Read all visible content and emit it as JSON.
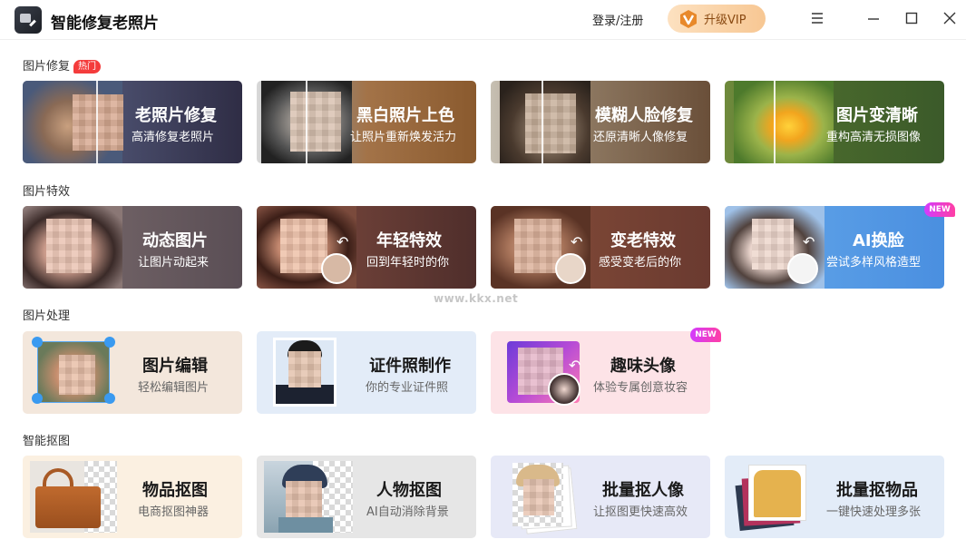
{
  "app": {
    "title": "智能修复老照片"
  },
  "header": {
    "login_label": "登录/注册",
    "vip_label": "升级VIP"
  },
  "sections": {
    "repair": {
      "title": "图片修复",
      "badge": "热门"
    },
    "effects": {
      "title": "图片特效"
    },
    "processing": {
      "title": "图片处理"
    },
    "cutout": {
      "title": "智能抠图"
    }
  },
  "cards": {
    "old_photo": {
      "title": "老照片修复",
      "sub": "高清修复老照片"
    },
    "colorize": {
      "title": "黑白照片上色",
      "sub": "让照片重新焕发活力"
    },
    "blur_face": {
      "title": "模糊人脸修复",
      "sub": "还原清晰人像修复"
    },
    "sharpen": {
      "title": "图片变清晰",
      "sub": "重构高清无损图像"
    },
    "animate": {
      "title": "动态图片",
      "sub": "让图片动起来"
    },
    "younger": {
      "title": "年轻特效",
      "sub": "回到年轻时的你"
    },
    "older": {
      "title": "变老特效",
      "sub": "感受变老后的你"
    },
    "faceswap": {
      "title": "AI换脸",
      "sub": "尝试多样风格造型",
      "badge": "NEW"
    },
    "edit": {
      "title": "图片编辑",
      "sub": "轻松编辑图片"
    },
    "id_photo": {
      "title": "证件照制作",
      "sub": "你的专业证件照"
    },
    "fun_avatar": {
      "title": "趣味头像",
      "sub": "体验专属创意妆容",
      "badge": "NEW"
    },
    "object_cut": {
      "title": "物品抠图",
      "sub": "电商抠图神器"
    },
    "person_cut": {
      "title": "人物抠图",
      "sub": "AI自动消除背景"
    },
    "batch_person": {
      "title": "批量抠人像",
      "sub": "让抠图更快速高效"
    },
    "batch_object": {
      "title": "批量抠物品",
      "sub": "一键快速处理多张"
    }
  },
  "watermark": "www.kkx.net",
  "colors": {
    "vip_text": "#8a4a12",
    "hot_badge": "#f43c3c",
    "new_badge": "#e03cd0"
  }
}
